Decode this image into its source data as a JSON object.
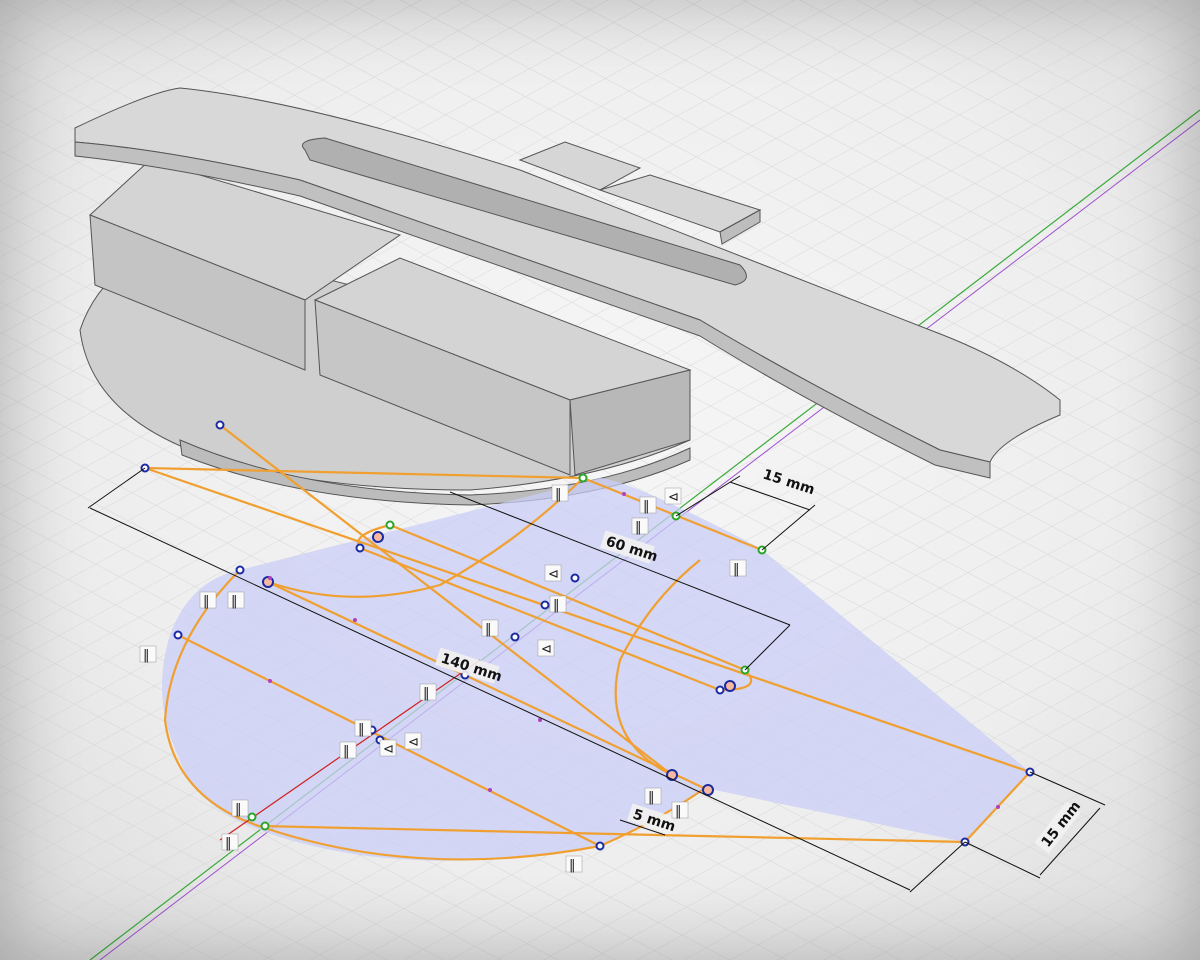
{
  "viewport": {
    "name": "cad-3d-viewport"
  },
  "dimensions": {
    "dim_top_right": "15 mm",
    "dim_middle": "60 mm",
    "dim_center": "140 mm",
    "dim_bottom_small": "5 mm",
    "dim_bottom_right": "15 mm"
  },
  "constraint_glyphs": {
    "equal": "‖",
    "coincident": "⊲",
    "tangent": "⊂"
  },
  "colors": {
    "sketch_line": "#f0a030",
    "sketch_fill": "#c9cdf5",
    "point_blue": "#1a2aa0",
    "point_green": "#2aa52a",
    "axis_green": "#3aaa3a",
    "axis_purple": "#a050d0",
    "axis_red": "#d02020",
    "solid_face_top": "#d3d3d3",
    "solid_face_side": "#c2c2c2",
    "solid_edge": "#555555",
    "grid_line": "#d6d6d6"
  }
}
